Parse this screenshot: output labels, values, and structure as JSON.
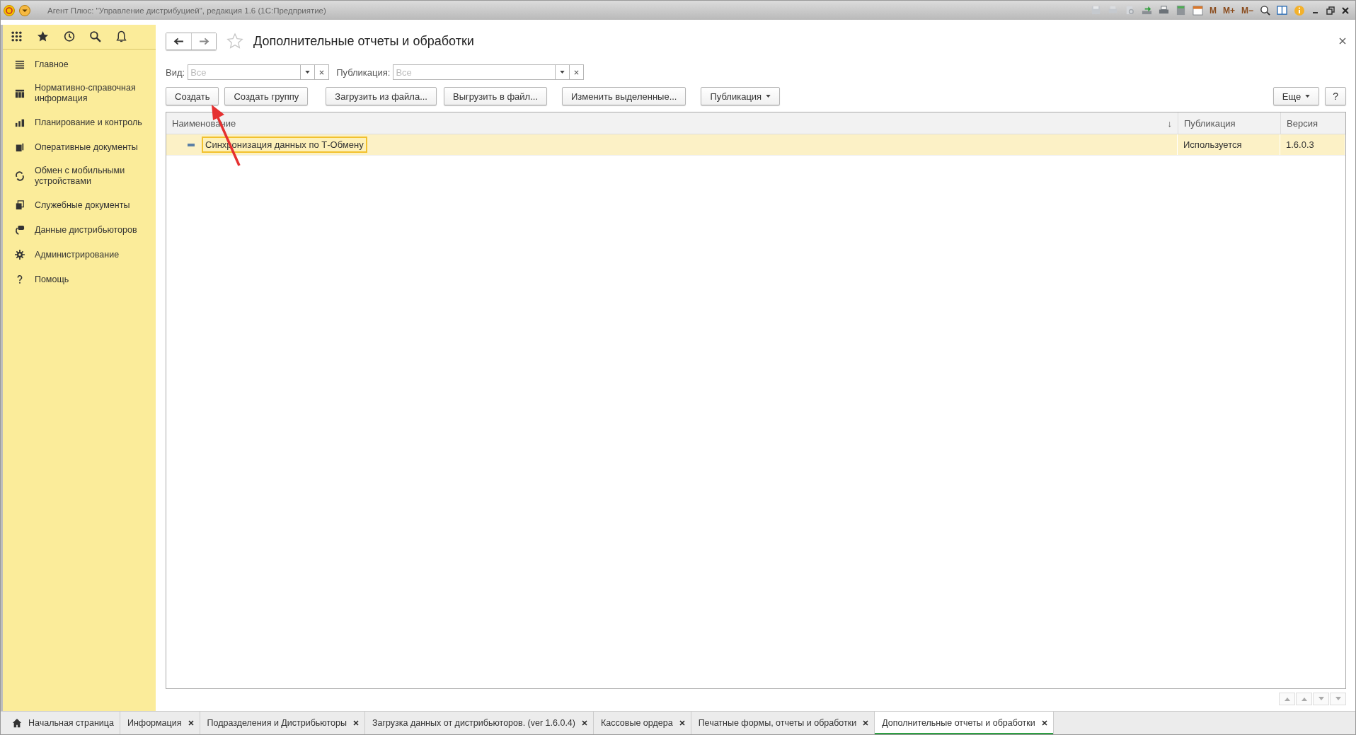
{
  "window": {
    "title": "Агент Плюс: \"Управление дистрибуцией\", редакция 1.6  (1С:Предприятие)",
    "memory_buttons": [
      "M",
      "M+",
      "M−"
    ]
  },
  "sidebar": {
    "items": [
      {
        "label": "Главное"
      },
      {
        "label": "Нормативно-справочная информация"
      },
      {
        "label": "Планирование и контроль"
      },
      {
        "label": "Оперативные документы"
      },
      {
        "label": "Обмен с мобильными устройствами"
      },
      {
        "label": "Служебные документы"
      },
      {
        "label": "Данные дистрибьюторов"
      },
      {
        "label": "Администрирование"
      },
      {
        "label": "Помощь"
      }
    ]
  },
  "form": {
    "title": "Дополнительные отчеты и обработки",
    "filters": [
      {
        "label": "Вид:",
        "placeholder": "Все"
      },
      {
        "label": "Публикация:",
        "placeholder": "Все"
      }
    ],
    "buttons": [
      {
        "label": "Создать",
        "dropdown": false
      },
      {
        "label": "Создать группу",
        "dropdown": false
      },
      {
        "label": "Загрузить из файла...",
        "dropdown": false
      },
      {
        "label": "Выгрузить в файл...",
        "dropdown": false
      },
      {
        "label": "Изменить выделенные...",
        "dropdown": false
      },
      {
        "label": "Публикация",
        "dropdown": true
      }
    ],
    "more_button": "Еще",
    "help_button": "?",
    "table": {
      "columns": [
        {
          "label": "Наименование",
          "sort_mark": "↓"
        },
        {
          "label": "Публикация"
        },
        {
          "label": "Версия"
        }
      ],
      "rows": [
        {
          "name": "Синхронизация данных по Т-Обмену",
          "publication": "Используется",
          "version": "1.6.0.3",
          "selected": true
        }
      ]
    }
  },
  "tabs": [
    {
      "label": "Начальная страница",
      "home": true,
      "selected": false
    },
    {
      "label": "Информация",
      "home": false,
      "selected": false
    },
    {
      "label": "Подразделения и Дистрибьюторы",
      "home": false,
      "selected": false
    },
    {
      "label": "Загрузка данных от дистрибьюторов. (ver 1.6.0.4)",
      "home": false,
      "selected": false
    },
    {
      "label": "Кассовые ордера",
      "home": false,
      "selected": false
    },
    {
      "label": "Печатные формы, отчеты и обработки",
      "home": false,
      "selected": false
    },
    {
      "label": "Дополнительные отчеты и обработки",
      "home": false,
      "selected": true
    }
  ]
}
